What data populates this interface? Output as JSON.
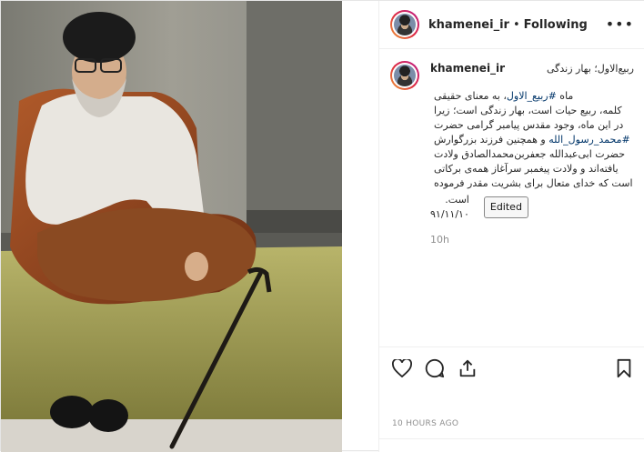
{
  "post": {
    "username": "khamenei_ir",
    "separator": "•",
    "follow_state": "Following",
    "more_label": "•••"
  },
  "caption": {
    "username": "khamenei_ir",
    "title": "ربیع‌الاول؛ بهار زندگی",
    "line1_pre": "ماه ",
    "hashtag1": "#ربیع_الاول",
    "line1_post": "، به معنای حقیقی",
    "line2": "کلمه، ربیع حیات است، بهار زندگی است؛ زیرا",
    "line3": "در این ماه، وجود مقدس پیامبر گرامی حضرت",
    "hashtag2": "#محمد_رسول_الله",
    "line4_post": " و همچنین فرزند بزرگوارش",
    "line5": "حضرت ابی‌عبدالله جعفربن‌محمدالصادق ولادت",
    "line6": "یافته‌اند و ولادت پیغمبر سرآغاز همه‌ی برکاتی",
    "line7": "است که خدای متعال برای بشریت مقدر فرموده",
    "line8": "است.",
    "date": "۹۱/۱۱/۱۰",
    "edited_label": "Edited",
    "time_ago": "10h"
  },
  "footer": {
    "posted_ago": "10 HOURS AGO"
  },
  "icons": [
    "heart-icon",
    "comment-icon",
    "share-icon",
    "bookmark-icon",
    "more-icon"
  ],
  "colors": {
    "avatar_ring": "#dc2743",
    "hashtag": "#003569",
    "muted": "#8e8e8e"
  }
}
